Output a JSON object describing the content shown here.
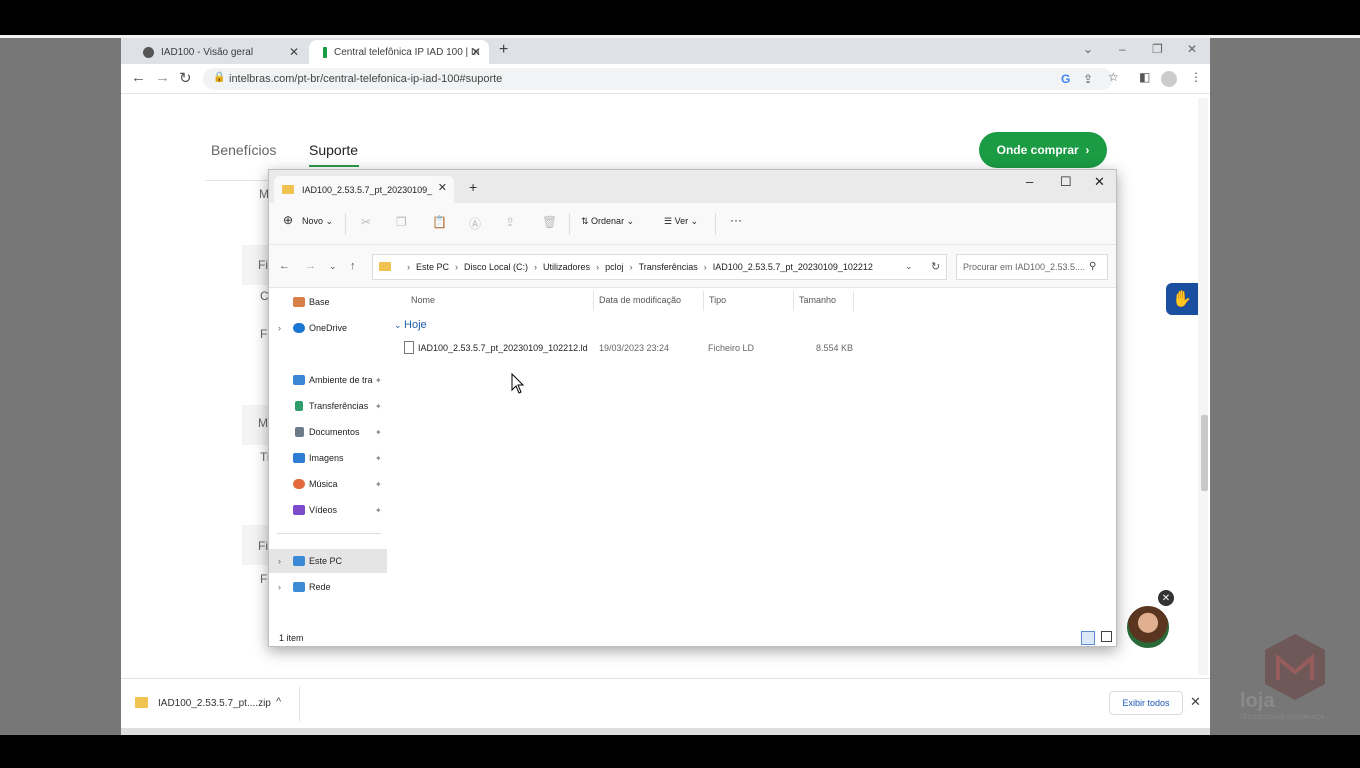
{
  "browser": {
    "tabs": [
      {
        "label": "IAD100 - Visão geral"
      },
      {
        "label": "Central telefônica IP IAD 100 | In"
      }
    ],
    "url": "intelbras.com/pt-br/central-telefonica-ip-iad-100#suporte"
  },
  "page": {
    "nav": {
      "beneficios": "Benefícios",
      "suporte": "Suporte"
    },
    "buy_button": "Onde comprar",
    "ghost_letters": [
      "M",
      "Fi",
      "C",
      "Fi",
      "M",
      "Ti",
      "Fi",
      "Fi"
    ]
  },
  "downloads": {
    "file": "IAD100_2.53.5.7_pt....zip",
    "show_all": "Exibir todos"
  },
  "explorer": {
    "tab_title": "IAD100_2.53.5.7_pt_20230109_",
    "toolbar": {
      "new": "Novo",
      "sort": "Ordenar",
      "view": "Ver",
      "more": "···"
    },
    "breadcrumb": [
      "Este PC",
      "Disco Local (C:)",
      "Utilizadores",
      "pcloj",
      "Transferências",
      "IAD100_2.53.5.7_pt_20230109_102212"
    ],
    "search_placeholder": "Procurar em IAD100_2.53.5....",
    "sidebar": [
      {
        "label": "Base",
        "icon": "home-icon",
        "color": "#d9804a"
      },
      {
        "label": "OneDrive",
        "icon": "onedrive-icon",
        "color": "#1976d2"
      },
      {
        "label": "Ambiente de tra",
        "icon": "desktop-icon",
        "color": "#3a86d4"
      },
      {
        "label": "Transferências",
        "icon": "download-icon",
        "color": "#2f9e6a"
      },
      {
        "label": "Documentos",
        "icon": "documents-icon",
        "color": "#6c7a8a"
      },
      {
        "label": "Imagens",
        "icon": "images-icon",
        "color": "#2d7dd2"
      },
      {
        "label": "Música",
        "icon": "music-icon",
        "color": "#e26a3c"
      },
      {
        "label": "Vídeos",
        "icon": "videos-icon",
        "color": "#7b4bc9"
      },
      {
        "label": "Este PC",
        "icon": "pc-icon",
        "color": "#3a8ad6"
      },
      {
        "label": "Rede",
        "icon": "network-icon",
        "color": "#3a8ad6"
      }
    ],
    "columns": {
      "name": "Nome",
      "modified": "Data de modificação",
      "type": "Tipo",
      "size": "Tamanho"
    },
    "group": "Hoje",
    "files": [
      {
        "name": "IAD100_2.53.5.7_pt_20230109_102212.ld",
        "modified": "19/03/2023 23:24",
        "type": "Ficheiro LD",
        "size": "8.554 KB"
      }
    ],
    "status": "1 item"
  },
  "watermark": {
    "line1": "loja",
    "line2": "TECNOLOGIA E SEGURANÇA"
  }
}
